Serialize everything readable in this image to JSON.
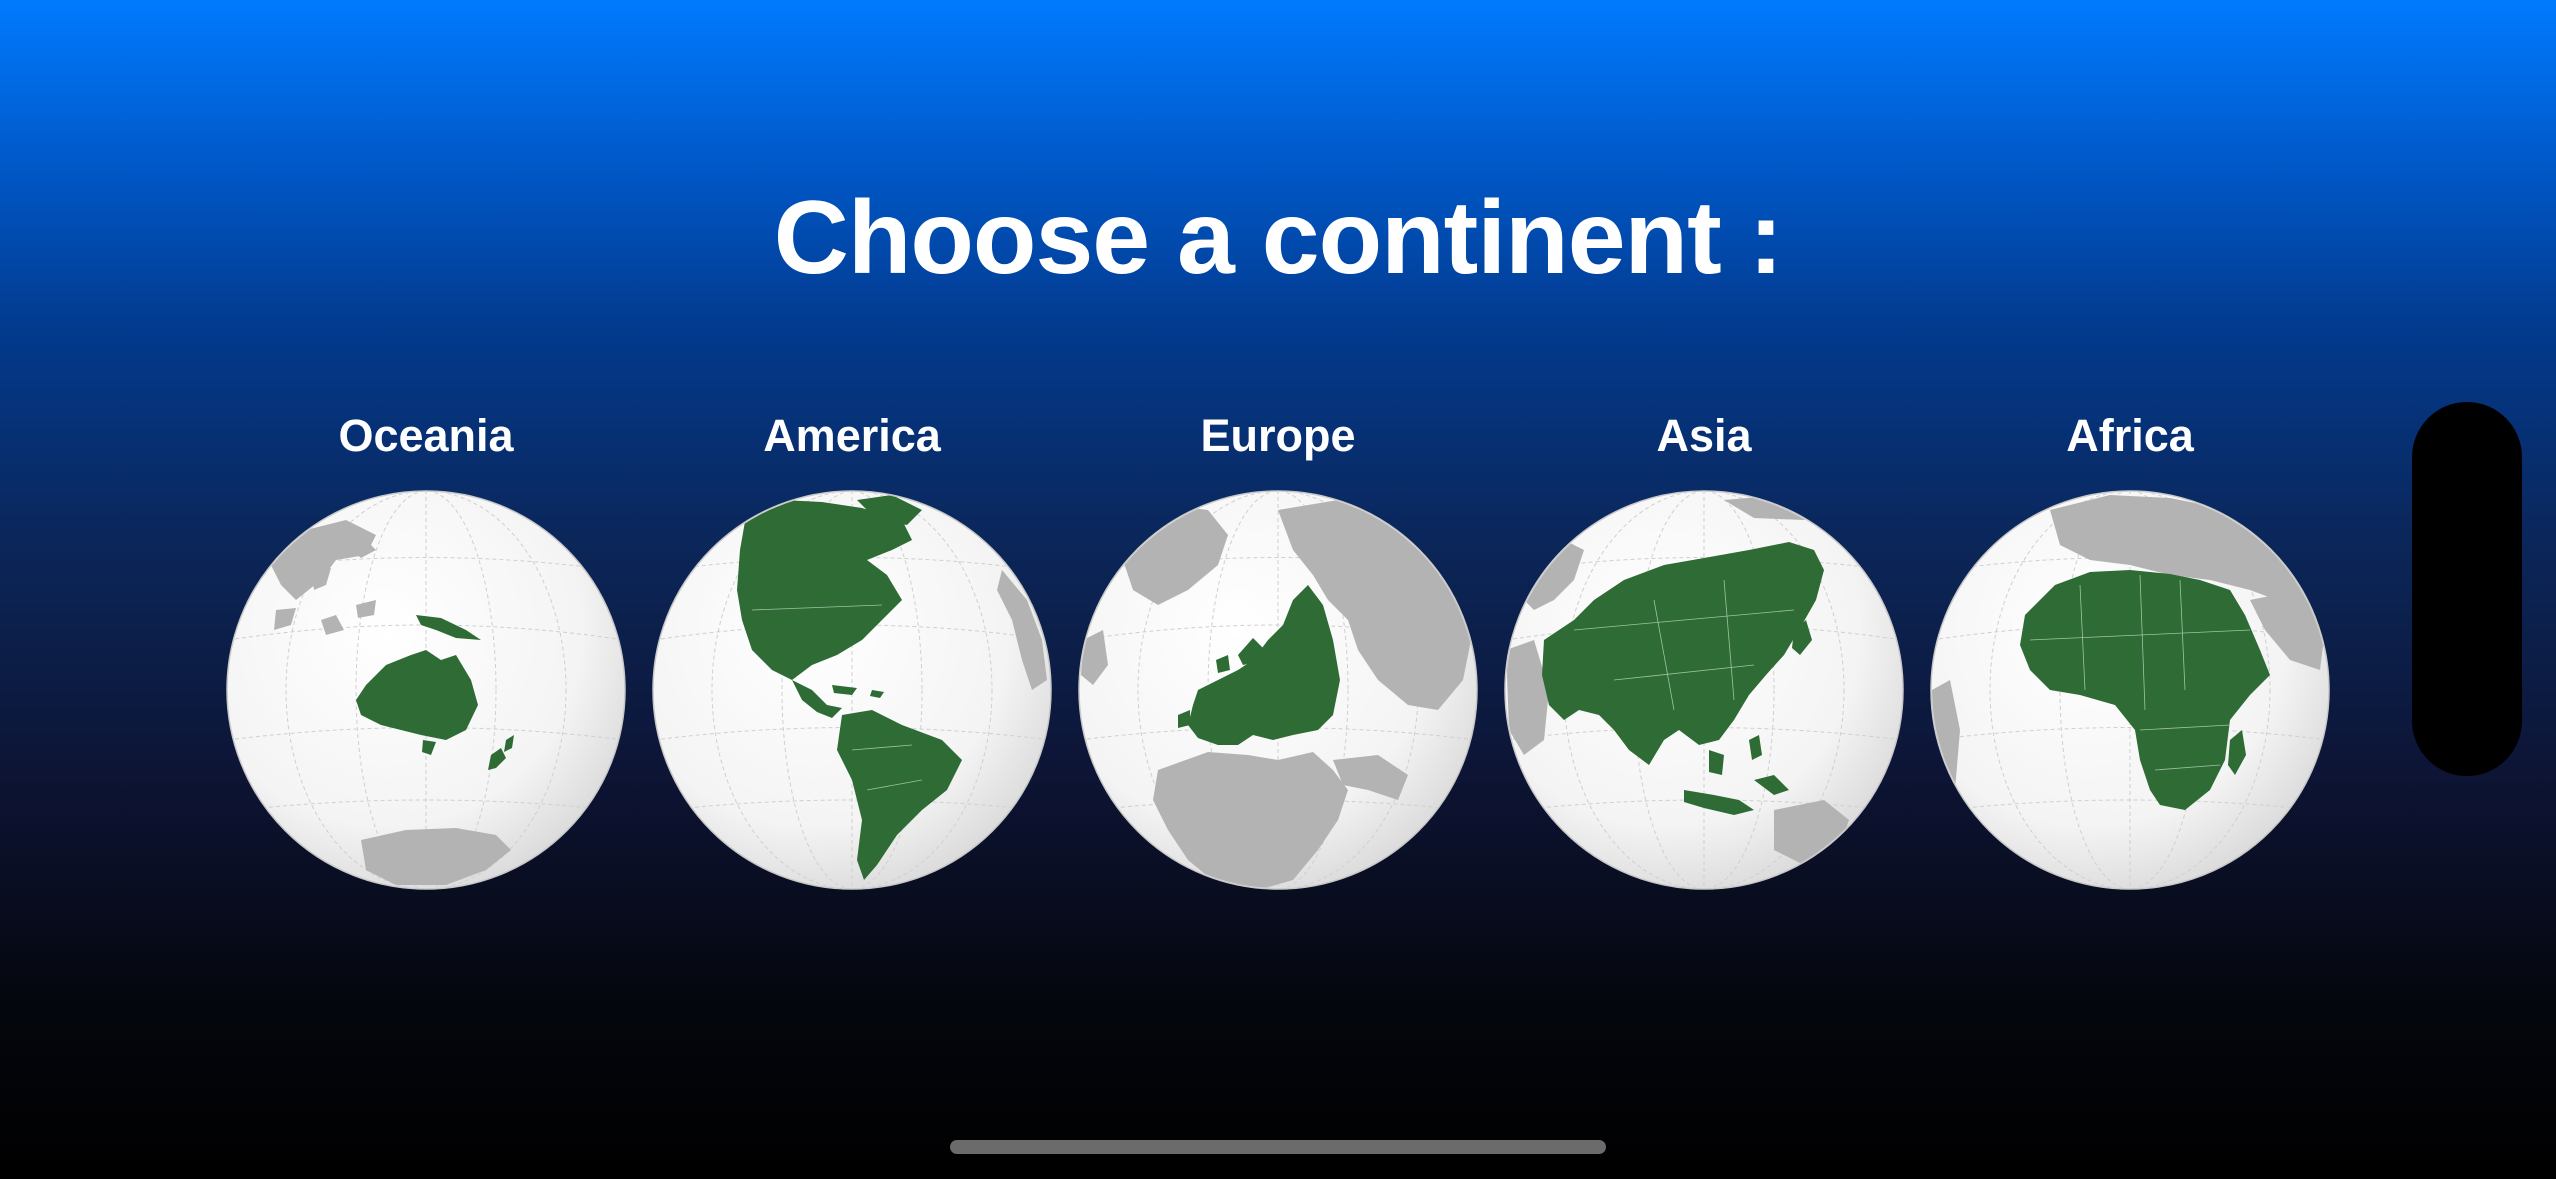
{
  "screen": {
    "title": "Choose a continent :"
  },
  "continents": [
    {
      "label": "Oceania",
      "icon": "globe-oceania-icon"
    },
    {
      "label": "America",
      "icon": "globe-america-icon"
    },
    {
      "label": "Europe",
      "icon": "globe-europe-icon"
    },
    {
      "label": "Asia",
      "icon": "globe-asia-icon"
    },
    {
      "label": "Africa",
      "icon": "globe-africa-icon"
    }
  ],
  "colors": {
    "background_top": "#007bfe",
    "background_bottom": "#000000",
    "highlight_land": "#2e6b35",
    "other_land": "#b3b3b3",
    "ocean": "#ffffff"
  }
}
